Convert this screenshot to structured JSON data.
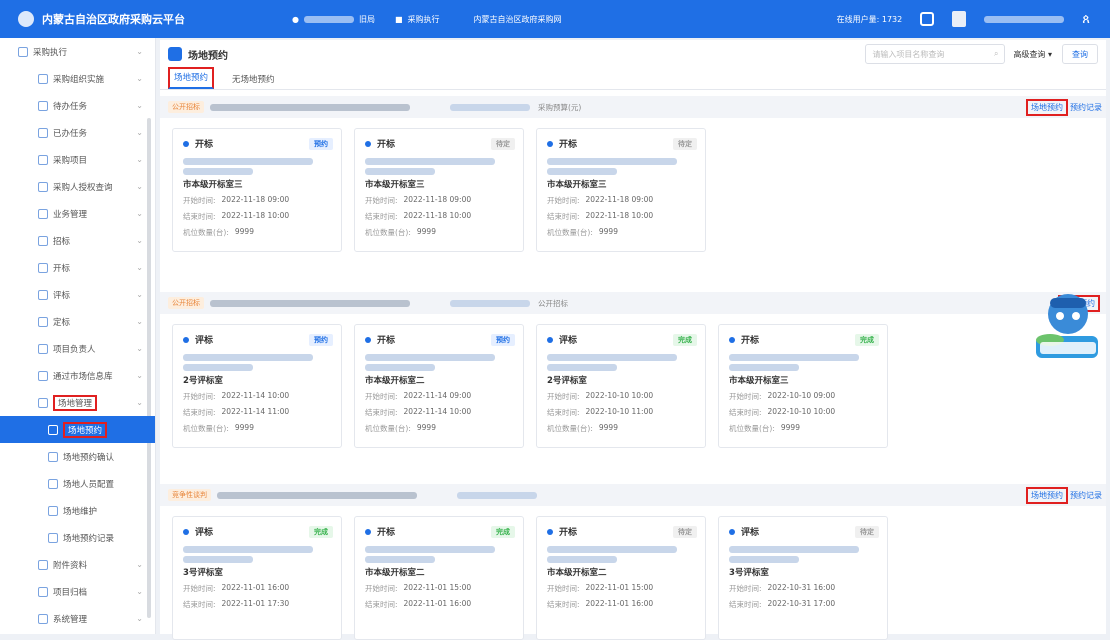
{
  "topbar": {
    "title": "内蒙古自治区政府采购云平台",
    "region_suffix": "旧局",
    "nav_label": "采购执行",
    "org_name": "内蒙古自治区政府采购网",
    "online_label": "在线用户量: 1732"
  },
  "page": {
    "title": "场地预约",
    "search_placeholder": "请输入项目名称查询",
    "advanced_search": "高级查询",
    "query_button": "查询",
    "tabs": [
      "场地预约",
      "无场地预约"
    ]
  },
  "sidebar": {
    "items": [
      {
        "label": "采购执行",
        "level": "top"
      },
      {
        "label": "采购组织实施",
        "level": "sub"
      },
      {
        "label": "待办任务",
        "level": "sub"
      },
      {
        "label": "已办任务",
        "level": "sub"
      },
      {
        "label": "采购项目",
        "level": "sub"
      },
      {
        "label": "采购人授权查询",
        "level": "sub"
      },
      {
        "label": "业务管理",
        "level": "sub"
      },
      {
        "label": "招标",
        "level": "sub"
      },
      {
        "label": "开标",
        "level": "sub"
      },
      {
        "label": "评标",
        "level": "sub"
      },
      {
        "label": "定标",
        "level": "sub"
      },
      {
        "label": "项目负责人",
        "level": "sub"
      },
      {
        "label": "通过市场信息库",
        "level": "sub"
      },
      {
        "label": "场地管理",
        "level": "sub"
      },
      {
        "label": "场地预约",
        "level": "subsub"
      },
      {
        "label": "场地预约确认",
        "level": "subsub"
      },
      {
        "label": "场地人员配置",
        "level": "subsub"
      },
      {
        "label": "场地维护",
        "level": "subsub"
      },
      {
        "label": "场地预约记录",
        "level": "subsub"
      },
      {
        "label": "附件资料",
        "level": "sub"
      },
      {
        "label": "项目归档",
        "level": "sub"
      },
      {
        "label": "系统管理",
        "level": "sub"
      }
    ]
  },
  "sections": [
    {
      "tag": "公开招标",
      "meta_label": "采购预算(元)",
      "book_link": "场地预约",
      "record_link": "预约记录",
      "cards": [
        {
          "type": "开标",
          "status": "预约",
          "status_color": "blue",
          "room": "市本级开标室三",
          "start": "2022-11-18 09:00",
          "end": "2022-11-18 10:00",
          "seats": "9999"
        },
        {
          "type": "开标",
          "status": "待定",
          "status_color": "gray",
          "room": "市本级开标室三",
          "start": "2022-11-18 09:00",
          "end": "2022-11-18 10:00",
          "seats": "9999"
        },
        {
          "type": "开标",
          "status": "待定",
          "status_color": "gray",
          "room": "市本级开标室三",
          "start": "2022-11-18 09:00",
          "end": "2022-11-18 10:00",
          "seats": "9999"
        }
      ]
    },
    {
      "tag": "公开招标",
      "meta_label": "公开招标",
      "book_link": "场地预约",
      "record_link": "",
      "cards": [
        {
          "type": "评标",
          "status": "预约",
          "status_color": "blue",
          "room": "2号评标室",
          "start": "2022-11-14 10:00",
          "end": "2022-11-14 11:00",
          "seats": "9999"
        },
        {
          "type": "开标",
          "status": "预约",
          "status_color": "blue",
          "room": "市本级开标室二",
          "start": "2022-11-14 09:00",
          "end": "2022-11-14 10:00",
          "seats": "9999"
        },
        {
          "type": "评标",
          "status": "完成",
          "status_color": "green",
          "room": "2号评标室",
          "start": "2022-10-10 10:00",
          "end": "2022-10-10 11:00",
          "seats": "9999"
        },
        {
          "type": "开标",
          "status": "完成",
          "status_color": "green",
          "room": "市本级开标室三",
          "start": "2022-10-10 09:00",
          "end": "2022-10-10 10:00",
          "seats": "9999"
        }
      ]
    },
    {
      "tag": "竞争性谈判",
      "meta_label": "",
      "book_link": "场地预约",
      "record_link": "预约记录",
      "cards": [
        {
          "type": "评标",
          "status": "完成",
          "status_color": "green",
          "room": "3号评标室",
          "start": "2022-11-01 16:00",
          "end": "2022-11-01 17:30",
          "seats": ""
        },
        {
          "type": "开标",
          "status": "完成",
          "status_color": "green",
          "room": "市本级开标室二",
          "start": "2022-11-01 15:00",
          "end": "2022-11-01 16:00",
          "seats": ""
        },
        {
          "type": "开标",
          "status": "待定",
          "status_color": "gray",
          "room": "市本级开标室二",
          "start": "2022-11-01 15:00",
          "end": "2022-11-01 16:00",
          "seats": ""
        },
        {
          "type": "评标",
          "status": "待定",
          "status_color": "gray",
          "room": "3号评标室",
          "start": "2022-10-31 16:00",
          "end": "2022-10-31 17:00",
          "seats": ""
        }
      ]
    }
  ],
  "card_labels": {
    "start": "开始时间:",
    "end": "结束时间:",
    "seats": "机位数量(台):"
  }
}
